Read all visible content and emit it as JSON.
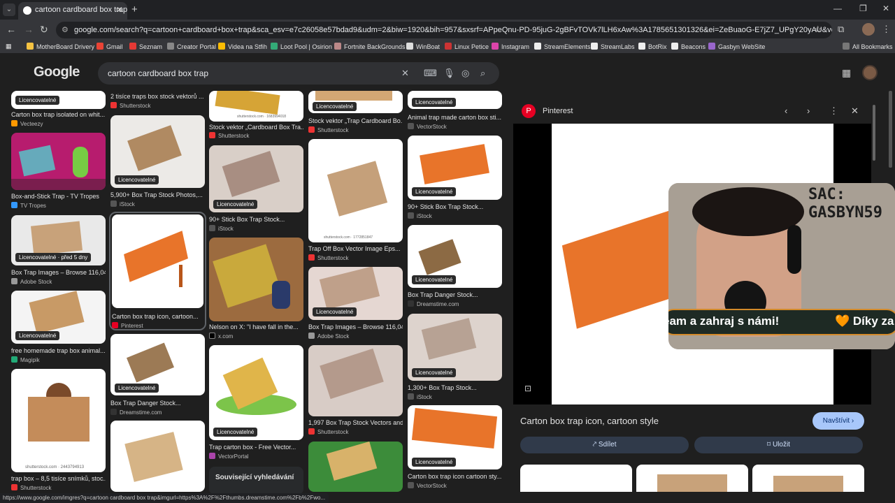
{
  "browser": {
    "tab_title": "cartoon cardboard box trap - Hl",
    "url": "google.com/search?q=cartoon+cardboard+box+trap&sca_esv=e7c26058e57bdad9&udm=2&biw=1920&bih=957&sxsrf=APpeQnu-PD-95juG-2gBFvTOVk7lLH6xAw%3A1785651301326&ei=ZeBuaoG-E7jZ7_UPgY20yAU&ved=0ahUKEwjBhli8pYGWAxW47...",
    "bookmarks": [
      "MotherBoard Drivery",
      "Gmail",
      "Seznam",
      "Creator Portal",
      "Videa na Stfih",
      "Loot Pool | Osirion",
      "Fortnite BackGrounds",
      "WinBoat",
      "Linux Petice",
      "Instagram",
      "StreamElements",
      "StreamLabs",
      "BotRix",
      "Beacons",
      "Gasbyn WebSite"
    ],
    "all_bookmarks": "All Bookmarks",
    "status_url": "https://www.google.com/imgres?q=cartoon cardboard box trap&imgurl=https%3A%2F%2Fthumbs.dreamstime.com%2Fb%2Fwo..."
  },
  "google": {
    "logo": "Google",
    "query": "cartoon cardboard box trap"
  },
  "grid": {
    "lic": "Licencovatelné",
    "lic_old": "Licencovatelné · před 5 dny",
    "related": "Související vyhledávání",
    "col1": [
      {
        "title": "Carton box trap isolated on whit...",
        "src": "Vecteezy"
      },
      {
        "title": "Box-and-Stick Trap - TV Tropes",
        "src": "TV Tropes"
      },
      {
        "title": "Box Trap Images – Browse 116,04...",
        "src": "Adobe Stock"
      },
      {
        "title": "free homemade trap box animal...",
        "src": "Magipik"
      },
      {
        "title": "trap box – 8,5 tisíce snímků, stoc...",
        "src": "Shutterstock"
      }
    ],
    "col2": [
      {
        "title": "2 tisíce traps box stock vektorů ...",
        "src": "Shutterstock"
      },
      {
        "title": "5,900+ Box Trap Stock Photos,...",
        "src": "iStock"
      },
      {
        "title": "Carton box trap icon, cartoon...",
        "src": "Pinterest"
      },
      {
        "title": "Box Trap Danger Stock...",
        "src": "Dreamstime.com"
      }
    ],
    "col3": [
      {
        "title": "Stock vektor „Cardboard Box Tra...",
        "src": "Shutterstock"
      },
      {
        "title": "90+ Stick Box Trap Stock...",
        "src": "iStock"
      },
      {
        "title": "Nelson on X: \"I have fall in the...",
        "src": "x.com"
      },
      {
        "title": "Trap carton box - Free Vector...",
        "src": "VectorPortal"
      }
    ],
    "col4": [
      {
        "title": "Stock vektor „Trap Cardboard Bo...",
        "src": "Shutterstock"
      },
      {
        "title": "Trap Off Box Vector Image Eps...",
        "src": "Shutterstock"
      },
      {
        "title": "Box Trap Images – Browse 116,04...",
        "src": "Adobe Stock"
      },
      {
        "title": "1,997 Box Trap Stock Vectors and...",
        "src": "Shutterstock"
      }
    ],
    "col5": [
      {
        "title": "Animal trap made carton box sti...",
        "src": "VectorStock"
      },
      {
        "title": "90+ Stick Box Trap Stock...",
        "src": "iStock"
      },
      {
        "title": "Box Trap Danger Stock...",
        "src": "Dreamstime.com"
      },
      {
        "title": "1,300+ Box Trap Stock...",
        "src": "iStock"
      },
      {
        "title": "Carton box trap icon cartoon sty...",
        "src": "VectorStock"
      }
    ],
    "watermarks": [
      "shutterstock.com · 1683994018",
      "shutterstock.com · 1772851847",
      "shutterstock.com · 2443794913"
    ]
  },
  "panel": {
    "source": "Pinterest",
    "title": "Carton box trap icon, cartoon style",
    "visit": "Navštívit ›",
    "share": "Sdílet",
    "save": "Uložit"
  },
  "overlay": {
    "sac": "SAC:\nGASBYN59",
    "ticker": "eam a zahraj s námi!",
    "thanks": "🧡 Díky za"
  },
  "colors": {
    "accent": "#a8c7fa",
    "orange": "#e8742a",
    "cardboard": "#c8a27a"
  }
}
